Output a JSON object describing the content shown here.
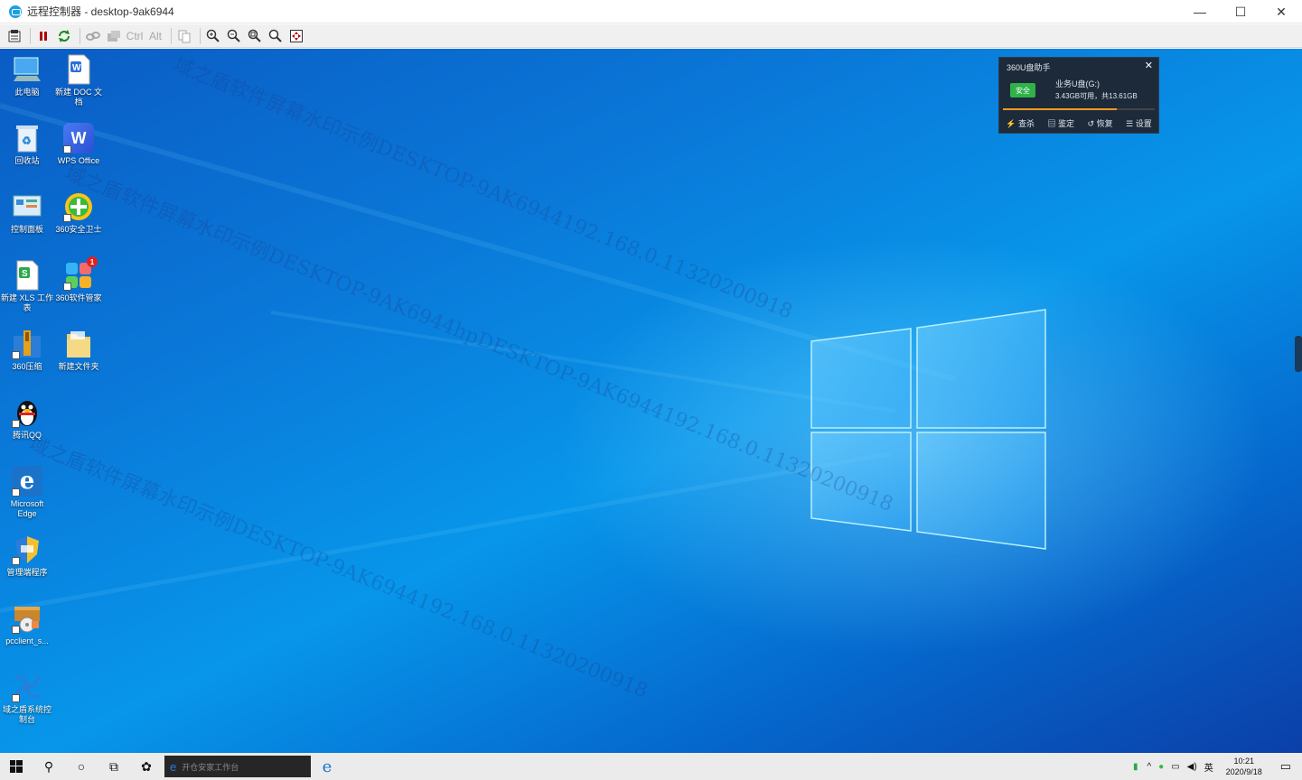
{
  "window": {
    "title": "远程控制器 - desktop-9ak6944",
    "minimize_glyph": "—",
    "maximize_glyph": "☐",
    "close_glyph": "✕"
  },
  "toolbar": {
    "ctrl_label": "Ctrl",
    "alt_label": "Alt"
  },
  "desktop_icons": [
    {
      "label": "此电脑"
    },
    {
      "label": "新建 DOC 文档"
    },
    {
      "label": "回收站"
    },
    {
      "label": "WPS Office"
    },
    {
      "label": "控制面板"
    },
    {
      "label": "360安全卫士"
    },
    {
      "label": "新建 XLS 工作表"
    },
    {
      "label": "360软件管家"
    },
    {
      "label": "360压缩"
    },
    {
      "label": "新建文件夹"
    },
    {
      "label": "腾讯QQ"
    },
    {
      "label": "Microsoft Edge"
    },
    {
      "label": "管理端程序"
    },
    {
      "label": "pcclient_s..."
    },
    {
      "label": "域之盾系统控制台"
    }
  ],
  "icon_badge": "1",
  "watermarks": [
    "域之盾软件屏幕水印示例DESKTOP-9AK6944192.168.0.11320200918",
    "域之盾软件屏幕水印示例DESKTOP-9AK6944hpDESKTOP-9AK6944192.168.0.11320200918",
    "域之盾软件屏幕水印示例DESKTOP-9AK6944192.168.0.11320200918"
  ],
  "usb_popup": {
    "title": "360U盘助手",
    "safe_label": "安全",
    "drive_name": "业务U盘(G:)",
    "drive_info": "3.43GB可用，共13.61GB",
    "used_fraction": 0.75,
    "actions": [
      "查杀",
      "鉴定",
      "恢复",
      "设置"
    ]
  },
  "taskbar": {
    "search_placeholder": "开仓安家工作台",
    "ime": "英",
    "time": "10:21",
    "date": "2020/9/18"
  }
}
